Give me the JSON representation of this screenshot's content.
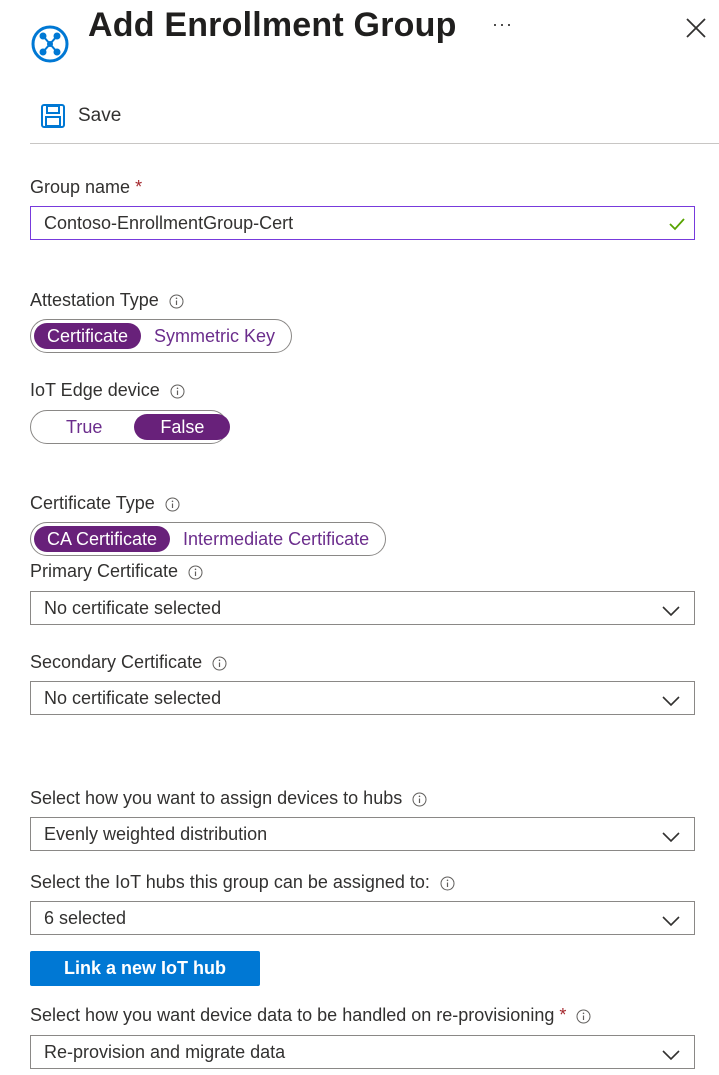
{
  "header": {
    "title": "Add Enrollment Group",
    "more_label": "···"
  },
  "toolbar": {
    "save_label": "Save"
  },
  "group_name": {
    "label": "Group name",
    "required": "*",
    "value": "Contoso-EnrollmentGroup-Cert"
  },
  "attestation": {
    "label": "Attestation Type",
    "options": [
      "Certificate",
      "Symmetric Key"
    ],
    "selected": "Certificate"
  },
  "iot_edge": {
    "label": "IoT Edge device",
    "options": [
      "True",
      "False"
    ],
    "selected": "False"
  },
  "certificate_type": {
    "label": "Certificate Type",
    "options": [
      "CA Certificate",
      "Intermediate Certificate"
    ],
    "selected": "CA Certificate"
  },
  "primary_certificate": {
    "label": "Primary Certificate",
    "value": "No certificate selected"
  },
  "secondary_certificate": {
    "label": "Secondary Certificate",
    "value": "No certificate selected"
  },
  "assign_policy": {
    "label": "Select how you want to assign devices to hubs",
    "value": "Evenly weighted distribution"
  },
  "iot_hubs": {
    "label": "Select the IoT hubs this group can be assigned to:",
    "value": "6 selected",
    "link_button": "Link a new IoT hub"
  },
  "reprovision": {
    "label": "Select how you want device data to be handled on re-provisioning",
    "required": "*",
    "value": "Re-provision and migrate data"
  },
  "colors": {
    "accent_purple": "#68217a",
    "primary_blue": "#0078d4",
    "valid_green": "#57a300",
    "required_red": "#a4262c"
  },
  "icons": [
    "dps-logo-icon",
    "more-icon",
    "close-icon",
    "save-icon",
    "checkmark-icon",
    "info-icon",
    "chevron-down-icon"
  ]
}
